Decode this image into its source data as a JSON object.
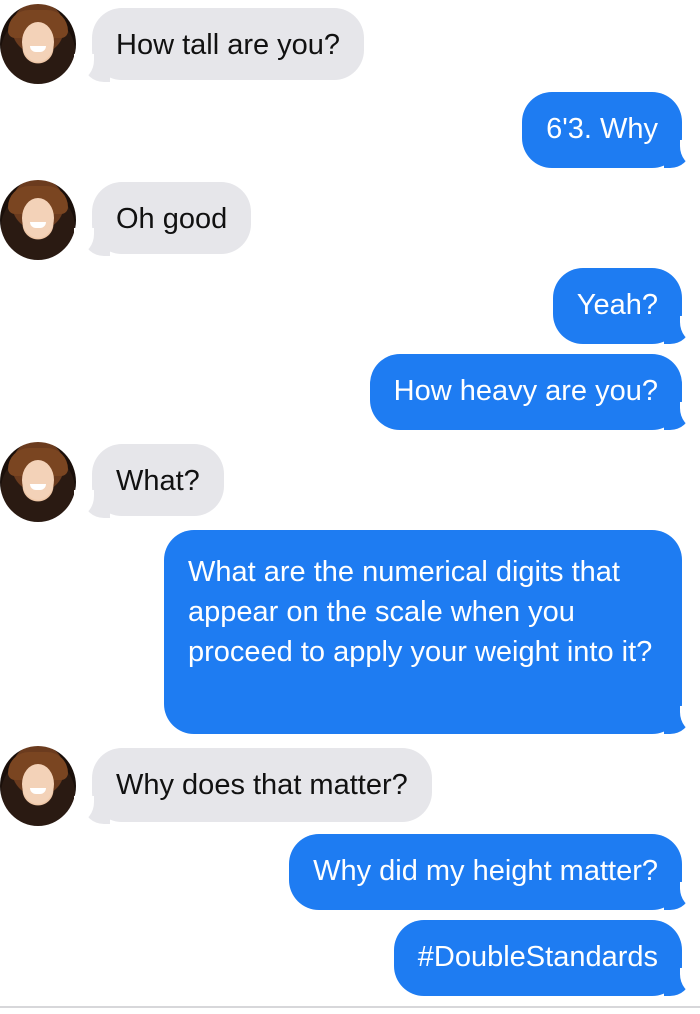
{
  "conversation": {
    "messages": [
      {
        "direction": "incoming",
        "text": "How tall are you?",
        "avatar": "contact-avatar"
      },
      {
        "direction": "outgoing",
        "text": "6'3. Why"
      },
      {
        "direction": "incoming",
        "text": "Oh good",
        "avatar": "contact-avatar"
      },
      {
        "direction": "outgoing",
        "text": "Yeah?"
      },
      {
        "direction": "outgoing",
        "text": "How heavy are you?"
      },
      {
        "direction": "incoming",
        "text": "What?",
        "avatar": "contact-avatar"
      },
      {
        "direction": "outgoing",
        "text": "What are the numerical digits that appear on the scale when you proceed to apply your weight into it?"
      },
      {
        "direction": "incoming",
        "text": "Why does that matter?",
        "avatar": "contact-avatar"
      },
      {
        "direction": "outgoing",
        "text": "Why did my height matter?"
      },
      {
        "direction": "outgoing",
        "text": "#DoubleStandards"
      }
    ]
  },
  "colors": {
    "incoming_bubble": "#e6e6ea",
    "outgoing_bubble": "#1e7cf2",
    "background": "#ffffff"
  }
}
